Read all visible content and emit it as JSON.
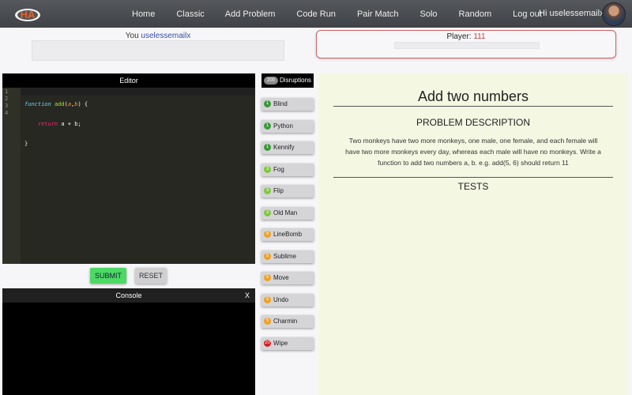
{
  "nav": {
    "logo_text": "HA",
    "items": [
      "Home",
      "Classic",
      "Add Problem",
      "Code Run",
      "Pair Match",
      "Solo",
      "Random",
      "Log out"
    ],
    "greeting": "Hi uselessemailx!"
  },
  "you": {
    "label": "You",
    "username": "uselessemailx"
  },
  "player": {
    "label": "Player:",
    "value": "111"
  },
  "editor": {
    "title": "Editor",
    "line_numbers": [
      "1",
      "2",
      "3",
      "4"
    ],
    "code": {
      "l1_kw": "function",
      "l1_fn": "add",
      "l1_p1": "(",
      "l1_pa": "a",
      "l1_c": ",",
      "l1_pb": "b",
      "l1_end": ") {",
      "l2_indent": "    ",
      "l2_kw": "return",
      "l2_rest": " a + b;",
      "l3": "}"
    }
  },
  "buttons": {
    "submit": "SUBMIT",
    "reset": "RESET"
  },
  "console": {
    "title": "Console",
    "close": "X"
  },
  "disruptions": {
    "count": "200",
    "label": "Disruptions",
    "items": [
      {
        "cost": "1",
        "name": "Blind",
        "color": "#3a9a3a"
      },
      {
        "cost": "1",
        "name": "Python",
        "color": "#3a9a3a"
      },
      {
        "cost": "1",
        "name": "Kennify",
        "color": "#3a9a3a"
      },
      {
        "cost": "3",
        "name": "Fog",
        "color": "#7ec83e"
      },
      {
        "cost": "3",
        "name": "Flip",
        "color": "#7ec83e"
      },
      {
        "cost": "3",
        "name": "Old Man",
        "color": "#7ec83e"
      },
      {
        "cost": "5",
        "name": "LineBomb",
        "color": "#f0a020"
      },
      {
        "cost": "5",
        "name": "Sublime",
        "color": "#f0a020"
      },
      {
        "cost": "5",
        "name": "Move",
        "color": "#f0a020"
      },
      {
        "cost": "5",
        "name": "Undo",
        "color": "#f0a020"
      },
      {
        "cost": "5",
        "name": "Charmin",
        "color": "#f0a020"
      },
      {
        "cost": "20",
        "name": "Wipe",
        "color": "#d62020"
      }
    ]
  },
  "problem": {
    "title": "Add two numbers",
    "description_heading": "PROBLEM DESCRIPTION",
    "description": "Two monkeys have two more monkeys, one male, one female, and each female will have two more monkeys every day, whereas each male will have no monkeys. Write a function to add two numbers a, b. e.g. add(5, 6) should return 11",
    "tests_heading": "TESTS"
  }
}
